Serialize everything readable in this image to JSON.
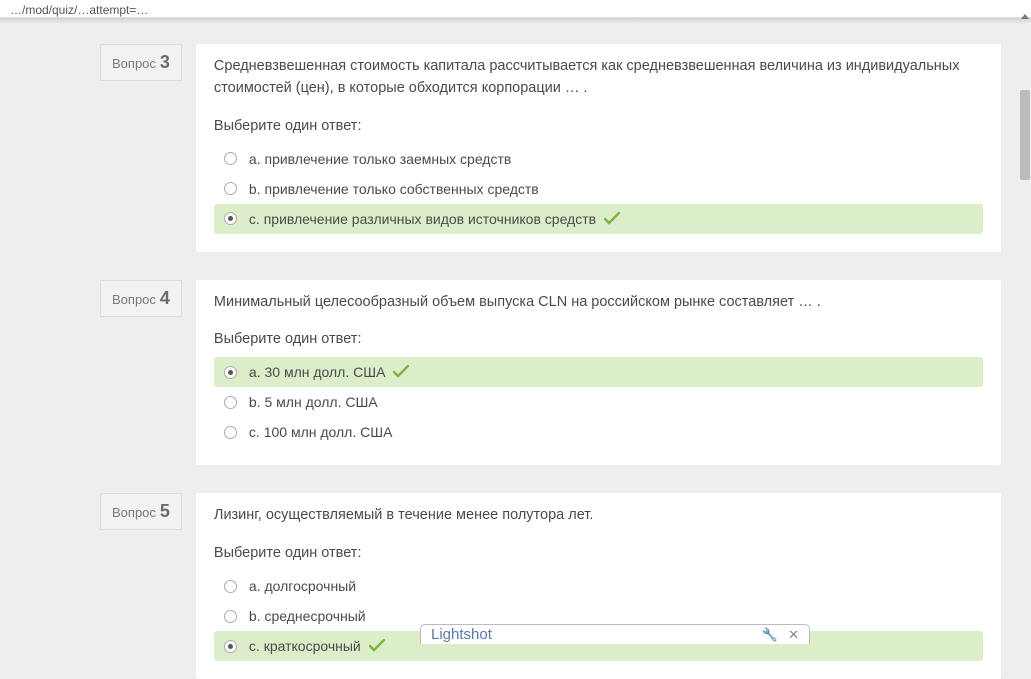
{
  "url_fragment": "…/mod/quiz/…attempt=…",
  "question_label": "Вопрос",
  "choose_one_label": "Выберите один ответ:",
  "questions": [
    {
      "number": "3",
      "text": "Средневзвешенная стоимость капитала рассчитывается как средневзвешенная величина из индивидуальных стоимостей (цен), в которые обходится корпорации … .",
      "options": [
        {
          "label": "a. привлечение только заемных средств",
          "selected": false,
          "correct": false
        },
        {
          "label": "b. привлечение только собственных средств",
          "selected": false,
          "correct": false
        },
        {
          "label": "c. привлечение различных видов источников средств",
          "selected": true,
          "correct": true
        }
      ]
    },
    {
      "number": "4",
      "text": "Минимальный целесообразный объем выпуска CLN на российском рынке составляет … .",
      "options": [
        {
          "label": "a. 30 млн долл. США",
          "selected": true,
          "correct": true
        },
        {
          "label": "b. 5 млн долл. США",
          "selected": false,
          "correct": false
        },
        {
          "label": "c. 100 млн долл. США",
          "selected": false,
          "correct": false
        }
      ]
    },
    {
      "number": "5",
      "text": "Лизинг, осуществляемый в течение менее полутора лет.",
      "options": [
        {
          "label": "a. долгосрочный",
          "selected": false,
          "correct": false
        },
        {
          "label": "b. среднесрочный",
          "selected": false,
          "correct": false
        },
        {
          "label": "c. краткосрочный",
          "selected": true,
          "correct": true
        }
      ]
    }
  ],
  "lightshot": {
    "title": "Lightshot"
  }
}
